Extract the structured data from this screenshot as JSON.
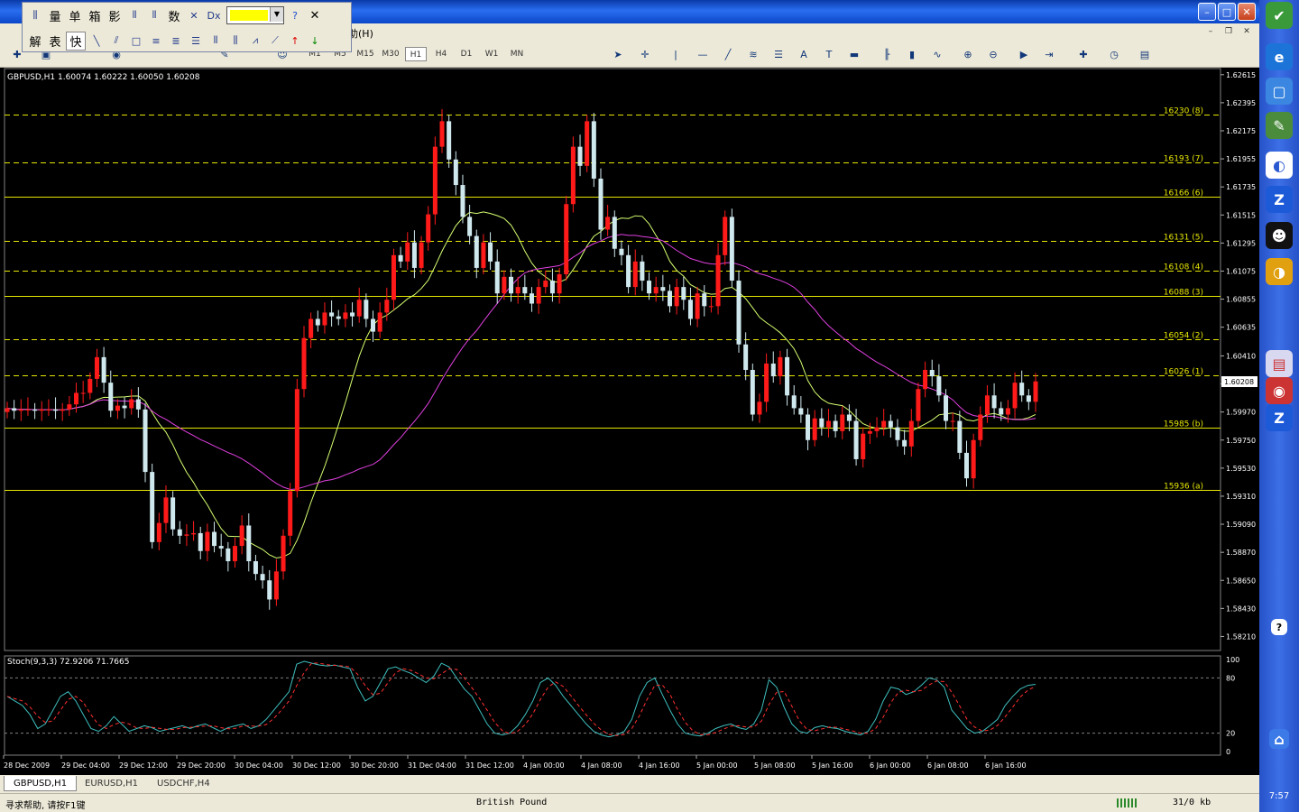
{
  "window": {
    "minimize": "–",
    "maximize": "□",
    "close": "✕"
  },
  "menu": {
    "help_fragment": "助(H)",
    "mdi": [
      "–",
      "❐",
      "✕"
    ]
  },
  "floating_toolbar": {
    "row1": [
      "量",
      "单",
      "箱",
      "影"
    ],
    "row2": [
      "解",
      "表",
      "快"
    ],
    "color_value": "#ffff00",
    "help_icon": "?",
    "close_icon": "✕"
  },
  "timeframes": [
    "M1",
    "M5",
    "M15",
    "M30",
    "H1",
    "H4",
    "D1",
    "W1",
    "MN"
  ],
  "active_timeframe": "H1",
  "tabs": [
    "GBPUSD,H1",
    "EURUSD,H1",
    "USDCHF,H4"
  ],
  "active_tab": "GBPUSD,H1",
  "status": {
    "help": "寻求帮助, 请按F1键",
    "profile": "British Pound",
    "traffic": "31/0 kb"
  },
  "clock": "7:57",
  "chart_data": {
    "type": "candlestick",
    "symbol_header": "GBPUSD,H1  1.60074 1.60222 1.60050 1.60208",
    "current_price": "1.60208",
    "ylim": [
      1.581,
      1.6267
    ],
    "yticks": [
      "1.62615",
      "1.62395",
      "1.62175",
      "1.61955",
      "1.61735",
      "1.61515",
      "1.61295",
      "1.61075",
      "1.60855",
      "1.60635",
      "1.60410",
      "1.60190",
      "1.59970",
      "1.59750",
      "1.59530",
      "1.59310",
      "1.59090",
      "1.58870",
      "1.58650",
      "1.58430",
      "1.58210"
    ],
    "xticks": [
      "28 Dec 2009",
      "29 Dec 04:00",
      "29 Dec 12:00",
      "29 Dec 20:00",
      "30 Dec 04:00",
      "30 Dec 12:00",
      "30 Dec 20:00",
      "31 Dec 04:00",
      "31 Dec 12:00",
      "4 Jan 00:00",
      "4 Jan 08:00",
      "4 Jan 16:00",
      "5 Jan 00:00",
      "5 Jan 08:00",
      "5 Jan 16:00",
      "6 Jan 00:00",
      "6 Jan 08:00",
      "6 Jan 16:00"
    ],
    "levels": [
      {
        "label": "16230 (8)",
        "price": 1.623,
        "style": "dash"
      },
      {
        "label": "16193 (7)",
        "price": 1.6193,
        "style": "dash"
      },
      {
        "label": "16166 (6)",
        "price": 1.6166,
        "style": "solid"
      },
      {
        "label": "16131 (5)",
        "price": 1.6131,
        "style": "dash"
      },
      {
        "label": "16108 (4)",
        "price": 1.6108,
        "style": "dash"
      },
      {
        "label": "16088 (3)",
        "price": 1.6088,
        "style": "solid"
      },
      {
        "label": "16054 (2)",
        "price": 1.6054,
        "style": "dash"
      },
      {
        "label": "16026 (1)",
        "price": 1.6026,
        "style": "dash"
      },
      {
        "label": "15985 (b)",
        "price": 1.5985,
        "style": "solid"
      },
      {
        "label": "15936 (a)",
        "price": 1.5936,
        "style": "solid"
      }
    ],
    "closes": [
      1.6,
      1.5998,
      1.5999,
      1.5999,
      1.5998,
      1.5999,
      1.5999,
      1.5998,
      1.5999,
      1.6003,
      1.6012,
      1.6012,
      1.6023,
      1.604,
      1.602,
      1.5998,
      1.6002,
      1.6,
      1.6007,
      1.5999,
      1.595,
      1.5895,
      1.591,
      1.593,
      1.5905,
      1.59,
      1.5901,
      1.5902,
      1.5888,
      1.5903,
      1.5892,
      1.589,
      1.588,
      1.5892,
      1.5908,
      1.588,
      1.587,
      1.5865,
      1.585,
      1.5872,
      1.59,
      1.5935,
      1.6015,
      1.6055,
      1.607,
      1.6065,
      1.6075,
      1.6072,
      1.607,
      1.6075,
      1.6072,
      1.6085,
      1.607,
      1.606,
      1.6075,
      1.6085,
      1.612,
      1.6115,
      1.613,
      1.611,
      1.613,
      1.6152,
      1.6205,
      1.6225,
      1.6195,
      1.6175,
      1.615,
      1.6135,
      1.611,
      1.613,
      1.6115,
      1.609,
      1.6103,
      1.609,
      1.6095,
      1.609,
      1.6082,
      1.6095,
      1.61,
      1.609,
      1.6105,
      1.616,
      1.6205,
      1.619,
      1.6225,
      1.618,
      1.614,
      1.615,
      1.6125,
      1.612,
      1.6095,
      1.6115,
      1.61,
      1.609,
      1.6095,
      1.6092,
      1.608,
      1.6095,
      1.6085,
      1.607,
      1.609,
      1.608,
      1.608,
      1.612,
      1.615,
      1.61,
      1.605,
      1.603,
      1.5995,
      1.6005,
      1.6035,
      1.6025,
      1.604,
      1.601,
      1.6,
      1.5995,
      1.5975,
      1.5992,
      1.5985,
      1.599,
      1.5982,
      1.5995,
      1.599,
      1.596,
      1.598,
      1.5982,
      1.5985,
      1.599,
      1.5985,
      1.5975,
      1.597,
      1.599,
      1.6015,
      1.603,
      1.6025,
      1.601,
      1.599,
      1.599,
      1.5965,
      1.5945,
      1.5975,
      1.5995,
      1.601,
      1.6,
      1.5995,
      1.6,
      1.602,
      1.601,
      1.6005,
      1.6021
    ],
    "stochastic": {
      "label": "Stoch(9,3,3) 72.9206 71.7665",
      "levels": [
        80,
        20
      ],
      "ticks": [
        "100",
        "80",
        "20",
        "0"
      ],
      "k": [
        60,
        55,
        50,
        40,
        25,
        30,
        45,
        60,
        65,
        55,
        40,
        25,
        22,
        28,
        38,
        30,
        22,
        25,
        28,
        26,
        22,
        24,
        26,
        28,
        25,
        28,
        30,
        26,
        22,
        26,
        28,
        30,
        25,
        28,
        35,
        45,
        55,
        65,
        95,
        98,
        96,
        94,
        93,
        94,
        92,
        90,
        70,
        55,
        60,
        75,
        90,
        92,
        88,
        85,
        80,
        75,
        82,
        96,
        92,
        80,
        68,
        60,
        45,
        30,
        20,
        18,
        20,
        28,
        40,
        55,
        75,
        80,
        72,
        60,
        50,
        40,
        30,
        22,
        18,
        16,
        18,
        22,
        35,
        60,
        75,
        80,
        62,
        45,
        30,
        20,
        18,
        17,
        20,
        25,
        28,
        30,
        26,
        24,
        30,
        45,
        78,
        70,
        48,
        30,
        22,
        20,
        26,
        28,
        26,
        25,
        22,
        20,
        18,
        22,
        35,
        55,
        70,
        68,
        62,
        65,
        72,
        80,
        78,
        70,
        45,
        35,
        25,
        20,
        22,
        28,
        35,
        50,
        60,
        68,
        72,
        73
      ]
    }
  }
}
